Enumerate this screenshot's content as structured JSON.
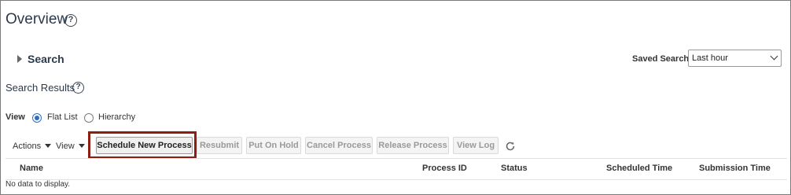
{
  "page": {
    "title": "Overview"
  },
  "search": {
    "label": "Search",
    "saved_search_label": "Saved Search",
    "saved_search_value": "Last hour"
  },
  "results": {
    "title": "Search Results",
    "view_label": "View",
    "view_options": [
      {
        "label": "Flat List",
        "selected": true
      },
      {
        "label": "Hierarchy",
        "selected": false
      }
    ]
  },
  "toolbar": {
    "actions_label": "Actions",
    "view_menu_label": "View",
    "buttons": {
      "schedule": "Schedule New Process",
      "resubmit": "Resubmit",
      "put_on_hold": "Put On Hold",
      "cancel": "Cancel Process",
      "release": "Release Process",
      "view_log": "View Log"
    },
    "refresh_icon": "refresh-icon"
  },
  "table": {
    "columns": {
      "name": "Name",
      "process_id": "Process ID",
      "status": "Status",
      "scheduled_time": "Scheduled Time",
      "submission_time": "Submission Time"
    },
    "empty_message": "No data to display."
  },
  "colors": {
    "highlight_border": "#8b1f10",
    "radio_selected": "#2d6fbf",
    "title_text": "#2b3a4d"
  }
}
